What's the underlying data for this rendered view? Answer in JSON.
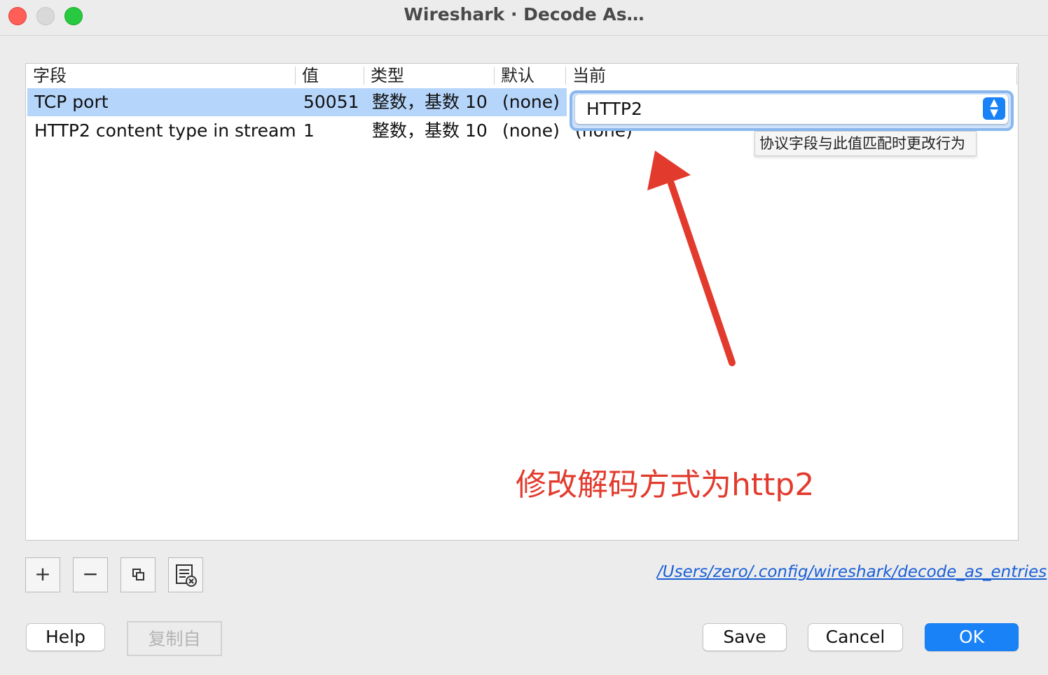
{
  "window": {
    "title": "Wireshark · Decode As…"
  },
  "table": {
    "columns": [
      "字段",
      "值",
      "类型",
      "默认",
      "当前"
    ],
    "rows": [
      {
        "field": "TCP port",
        "value": "50051",
        "type": "整数，基数 10",
        "default": "(none)",
        "current": "HTTP2"
      },
      {
        "field": "HTTP2 content type in stream",
        "value": "1",
        "type": "整数，基数 10",
        "default": "(none)",
        "current": "(none)"
      }
    ]
  },
  "combo": {
    "selected": "HTTP2",
    "tooltip": "协议字段与此值匹配时更改行为"
  },
  "annotation": {
    "text": "修改解码方式为http2",
    "color": "#e23b2e"
  },
  "toolbar": {
    "add_label": "+",
    "remove_label": "−",
    "copy_icon": "copy-icon",
    "clear_icon": "clear-list-icon"
  },
  "path_link": "/Users/zero/.config/wireshark/decode_as_entries",
  "buttons": {
    "help": "Help",
    "copy_from": "复制自",
    "save": "Save",
    "cancel": "Cancel",
    "ok": "OK"
  },
  "colors": {
    "accent": "#1a82f7",
    "selection": "#b5d5fb",
    "annotation": "#e23b2e"
  }
}
